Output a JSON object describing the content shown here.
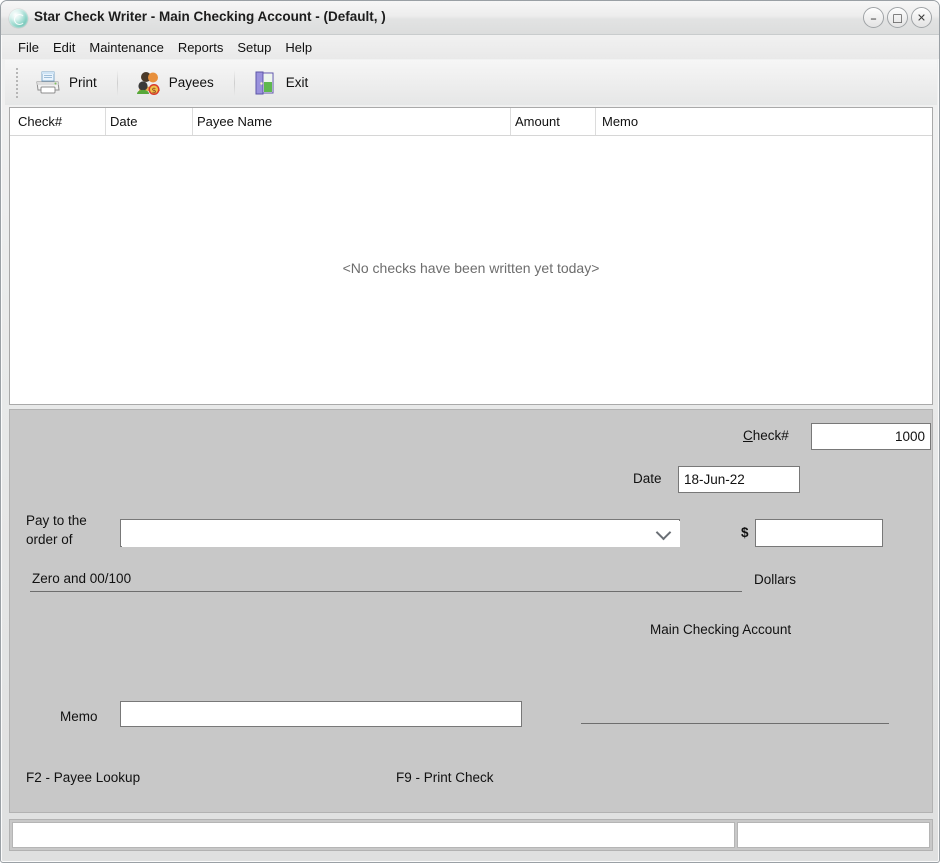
{
  "window": {
    "title": "Star Check Writer - Main Checking Account - (Default, )",
    "app_icon": "cd-disc-icon",
    "buttons": {
      "minimize": "–",
      "maximize": "□",
      "close": "✕"
    }
  },
  "menubar": {
    "items": [
      {
        "label": "File"
      },
      {
        "label": "Edit"
      },
      {
        "label": "Maintenance"
      },
      {
        "label": "Reports"
      },
      {
        "label": "Setup"
      },
      {
        "label": "Help"
      }
    ]
  },
  "toolbar": {
    "buttons": [
      {
        "label": "Print",
        "icon": "printer-icon"
      },
      {
        "label": "Payees",
        "icon": "payees-people-icon"
      },
      {
        "label": "Exit",
        "icon": "exit-door-icon"
      }
    ]
  },
  "check_list": {
    "columns": [
      {
        "label": "Check#"
      },
      {
        "label": "Date"
      },
      {
        "label": "Payee Name"
      },
      {
        "label": "Amount"
      },
      {
        "label": "Memo"
      }
    ],
    "rows": [],
    "empty_message": "<No checks have been written yet today>"
  },
  "check_form": {
    "check_number_label": "Check#",
    "check_number_accel": "C",
    "check_number_value": "1000",
    "date_label": "Date",
    "date_value": "18-Jun-22",
    "pay_to_label_line1": "Pay to the",
    "pay_to_label_line2": "order of",
    "payee_value": "",
    "dollar_sign": "$",
    "amount_value": "",
    "amount_placeholder": "",
    "written_amount": "Zero and 00/100",
    "dollars_label": "Dollars",
    "account_name": "Main Checking Account",
    "memo_label": "Memo",
    "memo_value": "",
    "signature_line": "",
    "hints": [
      {
        "label": "F2 - Payee Lookup"
      },
      {
        "label": "F9 - Print Check"
      }
    ]
  },
  "statusbar": {
    "main_text": "",
    "side_text": ""
  },
  "colors": {
    "form_background": "#c8c8c8",
    "list_background": "#ffffff",
    "empty_text": "#6d6d6d",
    "field_border": "#787878"
  }
}
